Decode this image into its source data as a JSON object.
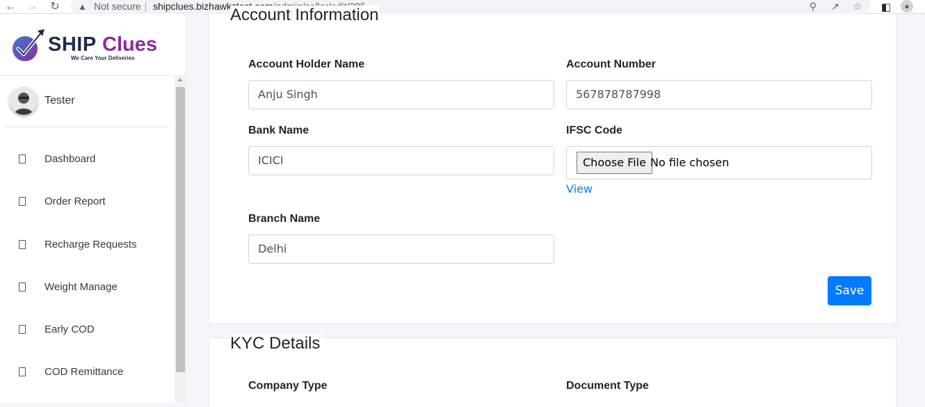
{
  "browser": {
    "security_label": "Not secure",
    "url_host": "shipclues.bizhawkztest.com",
    "url_path": "/admin/seller/edit/285"
  },
  "brand": {
    "name_part1": "SHIP",
    "name_part2": "Clues",
    "tagline": "We Care Your Deliveries"
  },
  "user": {
    "name": "Tester"
  },
  "sidebar": {
    "items": [
      {
        "label": "Dashboard"
      },
      {
        "label": "Order Report"
      },
      {
        "label": "Recharge Requests"
      },
      {
        "label": "Weight Manage"
      },
      {
        "label": "Early COD"
      },
      {
        "label": "COD Remittance"
      }
    ]
  },
  "account": {
    "legend": "Account Information",
    "holder_label": "Account Holder Name",
    "holder_value": "Anju Singh",
    "number_label": "Account Number",
    "number_value": "567878787998",
    "bank_label": "Bank Name",
    "bank_value": "ICICI",
    "ifsc_label": "IFSC Code",
    "file_button": "Choose File",
    "file_status": "No file chosen",
    "view_link": "View",
    "branch_label": "Branch Name",
    "branch_value": "Delhi",
    "save_label": "Save"
  },
  "kyc": {
    "legend": "KYC Details",
    "company_type_label": "Company Type",
    "document_type_label": "Document Type"
  },
  "colors": {
    "primary": "#007bff",
    "brand_dark": "#1d2b4f",
    "brand_purple": "#8e2a9e"
  }
}
